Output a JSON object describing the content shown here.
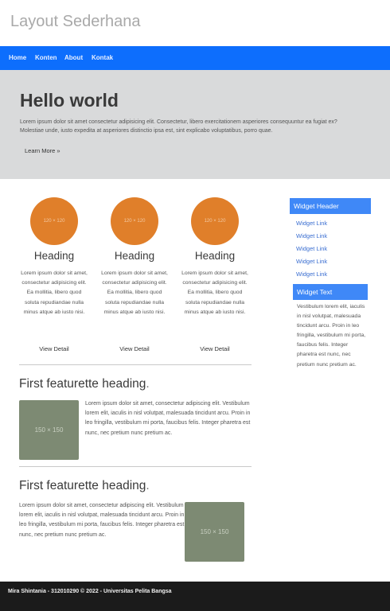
{
  "header": {
    "title": "Layout Sederhana"
  },
  "nav": {
    "items": [
      "Home",
      "Konten",
      "About",
      "Kontak"
    ]
  },
  "jumbotron": {
    "title": "Hello world",
    "text": "Lorem ipsum dolor sit amet consectetur adipisicing elit. Consectetur, libero exercitationem asperiores consequuntur ea fugiat ex? Molestiae unde, iusto expedita at asperiores distinctio ipsa est, sint explicabo voluptatibus, porro quae.",
    "button": "Learn More »"
  },
  "columns": [
    {
      "image_label": "120 × 120",
      "heading": "Heading",
      "text": "Lorem ipsum dolor sit amet, consectetur adipisicing elit. Ea mollitia, libero quod soluta repudiandae nulla minus atque ab iusto nisi.",
      "link": "View Detail"
    },
    {
      "image_label": "120 × 120",
      "heading": "Heading",
      "text": "Lorem ipsum dolor sit amet, consectetur adipisicing elit. Ea mollitia, libero quod soluta repudiandae nulla minus atque ab iusto nisi.",
      "link": "View Detail"
    },
    {
      "image_label": "120 × 120",
      "heading": "Heading",
      "text": "Lorem ipsum dolor sit amet, consectetur adipisicing elit. Ea mollitia, libero quod soluta repudiandae nulla minus atque ab iusto nisi.",
      "link": "View Detail"
    }
  ],
  "featurettes": [
    {
      "heading": "First featurette heading",
      "heading_suffix": ".",
      "image_label": "150 × 150",
      "text": "Lorem ipsum dolor sit amet, consectetur adipiscing elit. Vestibulum lorem elit, iaculis in nisl volutpat, malesuada tincidunt arcu. Proin in leo fringilla, vestibulum mi porta, faucibus felis. Integer pharetra est nunc, nec pretium nunc pretium ac."
    },
    {
      "heading": "First featurette heading",
      "heading_suffix": ".",
      "image_label": "150 × 150",
      "text": "Lorem ipsum dolor sit amet, consectetur adipiscing elit. Vestibulum lorem elit, iaculis in nisl volutpat, malesuada tincidunt arcu. Proin in leo fringilla, vestibulum mi porta, faucibus felis. Integer pharetra est nunc, nec pretium nunc pretium ac."
    }
  ],
  "sidebar": {
    "widget_header": "Widget Header",
    "links": [
      "Widget Link",
      "Widget Link",
      "Widget Link",
      "Widget Link",
      "Widget Link"
    ],
    "widget_text_title": "Widget Text",
    "widget_text": "Vestibulum lorem elit, iaculis in nisl volutpat, malesuada tincidunt arcu. Proin in leo fringilla, vestibulum mi porta, faucibus felis. Integer pharetra est nunc, nec pretium nunc pretium ac."
  },
  "footer": {
    "text": "Mira Shintania - 312010290 © 2022 - Universitas Pelita Bangsa"
  },
  "colors": {
    "nav": "#0d6efd",
    "jumbotron": "#d9dadb",
    "circle": "#e07f2a",
    "placeholder": "#7d8a73",
    "widget": "#3f88f7",
    "footer": "#1b1b1b"
  }
}
